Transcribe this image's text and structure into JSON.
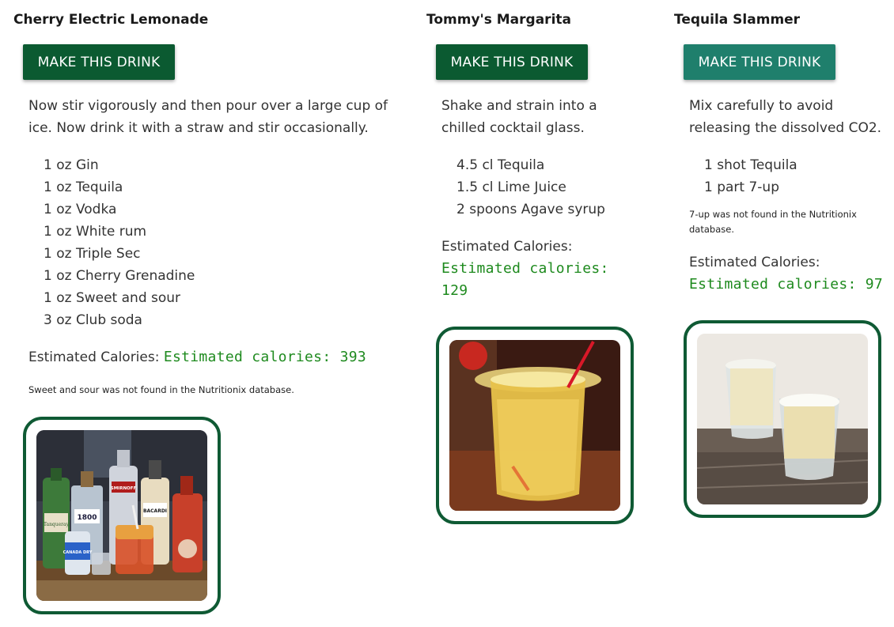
{
  "drinks": [
    {
      "name": "Cherry Electric Lemonade",
      "button_label": "MAKE THIS DRINK",
      "instructions": "Now stir vigorously and then pour over a large cup of ice. Now drink it with a straw and stir occasionally.",
      "ingredients": [
        "1 oz Gin",
        "1 oz Tequila",
        "1 oz Vodka",
        "1 oz White rum",
        "1 oz Triple Sec",
        "1 oz Cherry Grenadine",
        "1 oz Sweet and sour",
        "3 oz Club soda"
      ],
      "calories_label": "Estimated Calories:",
      "calories_value": "Estimated calories: 393",
      "note": "Sweet and sour was not found in the Nutritionix database.",
      "photo_labels": [
        "1800",
        "SMIRNOFF",
        "BACARDI",
        "CANADA DRY",
        "Tanqueray"
      ]
    },
    {
      "name": "Tommy's Margarita",
      "button_label": "MAKE THIS DRINK",
      "instructions": "Shake and strain into a chilled cocktail glass.",
      "ingredients": [
        "4.5 cl Tequila",
        "1.5 cl Lime Juice",
        "2 spoons Agave syrup"
      ],
      "calories_label": "Estimated Calories:",
      "calories_value": "Estimated calories: 129",
      "note": ""
    },
    {
      "name": "Tequila Slammer",
      "button_label": "MAKE THIS DRINK",
      "instructions": "Mix carefully to avoid releasing the dissolved CO2.",
      "ingredients": [
        "1 shot Tequila",
        "1 part 7-up"
      ],
      "calories_label": "Estimated Calories:",
      "calories_value": "Estimated calories: 97",
      "note": "7-up was not found in the Nutritionix database."
    }
  ],
  "colors": {
    "button_dark_green": "#0b5a31",
    "button_teal_hover": "#1f7f6c",
    "frame_green": "#0f5a34",
    "calorie_green": "#1e8a1e"
  }
}
